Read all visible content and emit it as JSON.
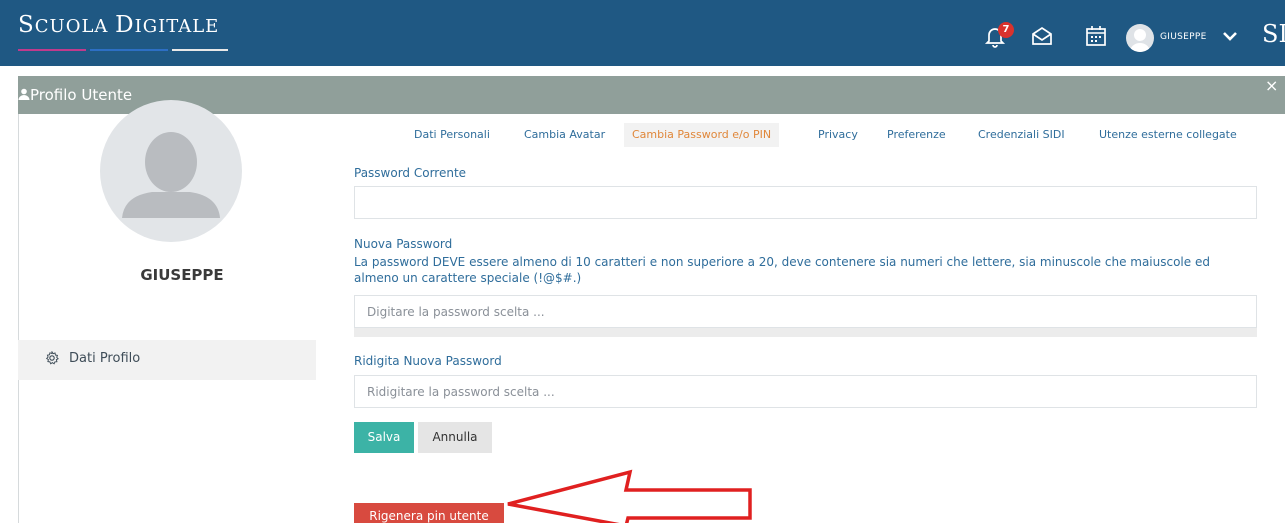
{
  "topbar": {
    "brand_first": "S",
    "brand_rest1": "CUOLA ",
    "brand_second": "D",
    "brand_rest2": "IGITALE",
    "notification_count": "7",
    "username": "GIUSEPPE",
    "logo_short": "SD",
    "colors": {
      "background": "#1f5883",
      "brand_line_pink": "#c03a8c",
      "brand_line_blue": "#2d6fc4"
    }
  },
  "modal": {
    "title": "Profilo Utente",
    "close": "×"
  },
  "left": {
    "name": "GIUSEPPE",
    "menu_item": "Dati Profilo"
  },
  "tabs": [
    {
      "label": "Dati Personali"
    },
    {
      "label": "Cambia Avatar"
    },
    {
      "label": "Cambia Password e/o PIN",
      "active": true
    },
    {
      "label": "Privacy"
    },
    {
      "label": "Preferenze"
    },
    {
      "label": "Credenziali SIDI"
    },
    {
      "label": "Utenze esterne collegate"
    }
  ],
  "form": {
    "current_password_label": "Password Corrente",
    "current_password_value": "",
    "new_password_label": "Nuova Password",
    "new_password_help": "La password DEVE essere almeno di 10 caratteri e non superiore a 20, deve contenere sia numeri che lettere, sia minuscole che maiuscole ed almeno un carattere speciale (!@$#.)",
    "new_password_placeholder": "Digitare la password scelta ...",
    "repeat_password_label": "Ridigita Nuova Password",
    "repeat_password_placeholder": "Ridigitare la password scelta ...",
    "save_label": "Salva",
    "cancel_label": "Annulla",
    "regen_label": "Rigenera pin utente"
  },
  "colors": {
    "accent_tab": "#e0873a",
    "link_blue": "#2f6d9b",
    "save_button": "#3cb3a6",
    "regen_button": "#d84a3f",
    "annotation_arrow": "#e02020"
  }
}
